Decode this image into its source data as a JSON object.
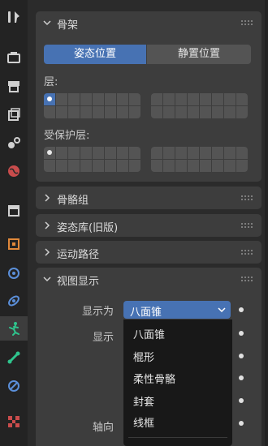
{
  "colors": {
    "accent": "#4772b3",
    "panel": "#3d3d3d",
    "background": "#2b2b2b",
    "sidebar": "#232323",
    "menu": "#181818"
  },
  "sidebar": {
    "tabs": [
      {
        "icon": "tool-icon"
      },
      {
        "icon": "render-icon"
      },
      {
        "icon": "output-icon"
      },
      {
        "icon": "view-layer-icon"
      },
      {
        "icon": "scene-icon"
      },
      {
        "icon": "world-icon"
      },
      {
        "icon": "collection-icon"
      },
      {
        "icon": "object-icon"
      },
      {
        "icon": "modifier-icon"
      },
      {
        "icon": "particles-icon"
      },
      {
        "icon": "armature-data-icon",
        "active": true
      },
      {
        "icon": "bone-icon"
      },
      {
        "icon": "bone-constraint-icon"
      },
      {
        "icon": "texture-icon"
      }
    ]
  },
  "skeleton": {
    "title": "骨架",
    "pose_position": "姿态位置",
    "rest_position": "静置位置",
    "layers_label": "层:",
    "protected_layers_label": "受保护层:"
  },
  "panels": {
    "bone_groups": "骨骼组",
    "pose_library": "姿态库(旧版)",
    "motion_paths": "运动路径",
    "viewport_display": "视图显示"
  },
  "viewport": {
    "display_as_label": "显示为",
    "display_as_value": "八面锥",
    "show_label": "显示",
    "axes_label": "轴向"
  },
  "menu": {
    "items": [
      "八面锥",
      "棍形",
      "柔性骨骼",
      "封套",
      "线框"
    ]
  }
}
